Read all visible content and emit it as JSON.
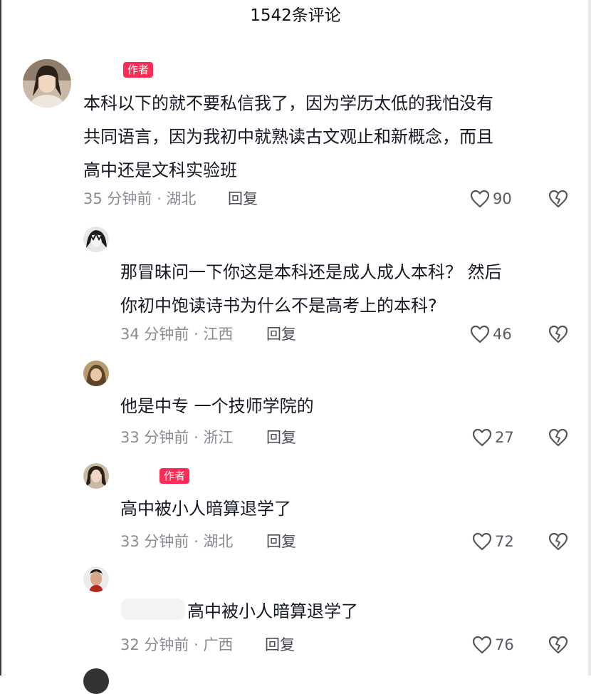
{
  "header": {
    "title": "1542条评论"
  },
  "comments": [
    {
      "badge": "作者",
      "lines": [
        "本科以下的就不要私信我了，因为学历太低的我怕没有",
        "共同语言，因为我初中就熟读古文观止和新概念，而且",
        "高中还是文科实验班"
      ],
      "meta": "35 分钟前 · 湖北",
      "reply": "回复",
      "likes": "90"
    },
    {
      "lines": [
        "那冒昧问一下你这是本科还是成人成人本科？ 然后",
        "你初中饱读诗书为什么不是高考上的本科?"
      ],
      "meta": "34 分钟前 · 江西",
      "reply": "回复",
      "likes": "46"
    },
    {
      "lines": [
        "他是中专 一个技师学院的"
      ],
      "meta": "33 分钟前 · 浙江",
      "reply": "回复",
      "likes": "27"
    },
    {
      "badge": "作者",
      "lines": [
        "高中被小人暗算退学了"
      ],
      "meta": "33 分钟前 · 湖北",
      "reply": "回复",
      "likes": "72"
    },
    {
      "lines": [
        "高中被小人暗算退学了"
      ],
      "meta": "32 分钟前 · 广西",
      "reply": "回复",
      "likes": "76"
    }
  ],
  "icons": {
    "like": "heart-outline-icon",
    "dislike": "broken-heart-icon"
  },
  "colors": {
    "badge": "#fe2c55",
    "meta": "#8a8b91",
    "text": "#161823"
  }
}
